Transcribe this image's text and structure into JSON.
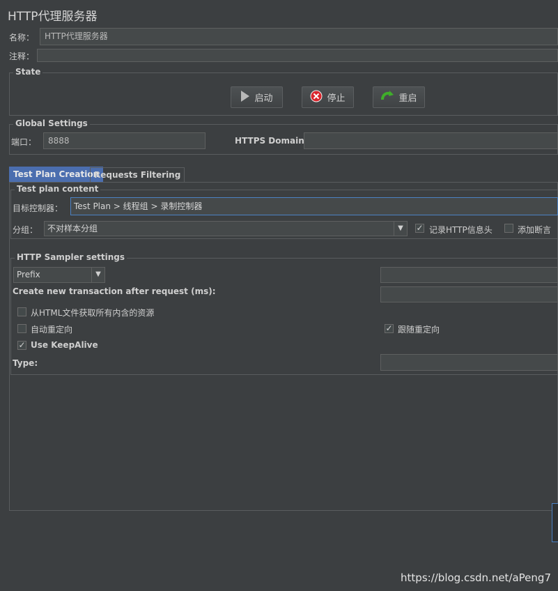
{
  "window": {
    "title": "HTTP代理服务器"
  },
  "fields": {
    "name_label": "名称：",
    "name_value": "HTTP代理服务器",
    "comment_label": "注释：",
    "comment_value": ""
  },
  "state": {
    "legend": "State",
    "start_label": "启动",
    "stop_label": "停止",
    "restart_label": "重启"
  },
  "global": {
    "legend": "Global Settings",
    "port_label": "端口：",
    "port_value": "8888",
    "https_label": "HTTPS Domains:",
    "https_value": ""
  },
  "tabs": [
    {
      "label": "Test Plan Creation",
      "active": true
    },
    {
      "label": "Requests Filtering",
      "active": false
    }
  ],
  "test_plan_content": {
    "legend": "Test plan content",
    "target_label": "目标控制器：",
    "target_value": "Test Plan > 线程组 > 录制控制器",
    "group_label": "分组：",
    "group_value": "不对样本分组",
    "record_headers_label": "记录HTTP信息头",
    "record_headers_checked": true,
    "add_assertion_label": "添加断言",
    "add_assertion_checked": false
  },
  "sampler": {
    "legend": "HTTP Sampler settings",
    "prefix_value": "Prefix",
    "prefix_text_value": "",
    "transaction_label": "Create new transaction after request (ms):",
    "transaction_value": "",
    "retrieve_resources_label": "从HTML文件获取所有内含的资源",
    "retrieve_resources_checked": false,
    "auto_redirect_label": "自动重定向",
    "auto_redirect_checked": false,
    "follow_redirect_label": "跟随重定向",
    "follow_redirect_checked": true,
    "keepalive_label": "Use KeepAlive",
    "keepalive_checked": true,
    "type_label": "Type:",
    "type_value": ""
  },
  "watermark": "https://blog.csdn.net/aPeng7",
  "colors": {
    "background": "#3c3f41",
    "field": "#45494a",
    "accent": "#4b6eaf",
    "stop_icon": "#d9262d",
    "restart_icon": "#3fae2a"
  }
}
